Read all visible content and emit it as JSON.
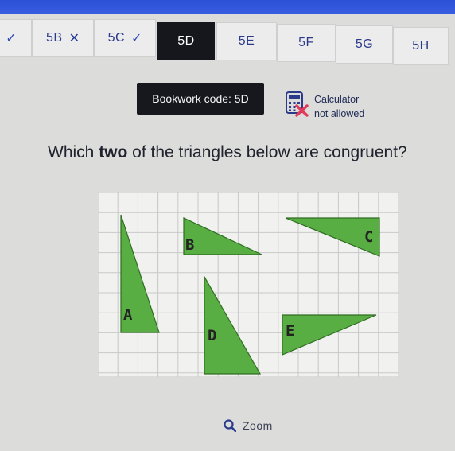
{
  "tabs": [
    {
      "label": "5B",
      "status": "cross"
    },
    {
      "label": "5C",
      "status": "tick"
    },
    {
      "label": "5D",
      "status": "active"
    },
    {
      "label": "5E",
      "status": "none"
    },
    {
      "label": "5F",
      "status": "none"
    },
    {
      "label": "5G",
      "status": "none"
    },
    {
      "label": "5H",
      "status": "none"
    }
  ],
  "bookwork": {
    "text": "Bookwork code: 5D"
  },
  "calculator": {
    "line1": "Calculator",
    "line2": "not allowed",
    "icon": "calculator-crossed-icon"
  },
  "question": {
    "prefix": "Which ",
    "emphasis": "two",
    "suffix": " of the triangles below are congruent?"
  },
  "triangles": {
    "a": "A",
    "b": "B",
    "c": "C",
    "d": "D",
    "e": "E"
  },
  "zoom": {
    "label": "Zoom",
    "icon": "search-icon"
  },
  "colors": {
    "triangle_fill": "#58ad43",
    "triangle_stroke": "#2f6e22",
    "active_tab": "#15171c",
    "tab_text": "#2c3a8c",
    "topbar": "#2b4fd6"
  }
}
